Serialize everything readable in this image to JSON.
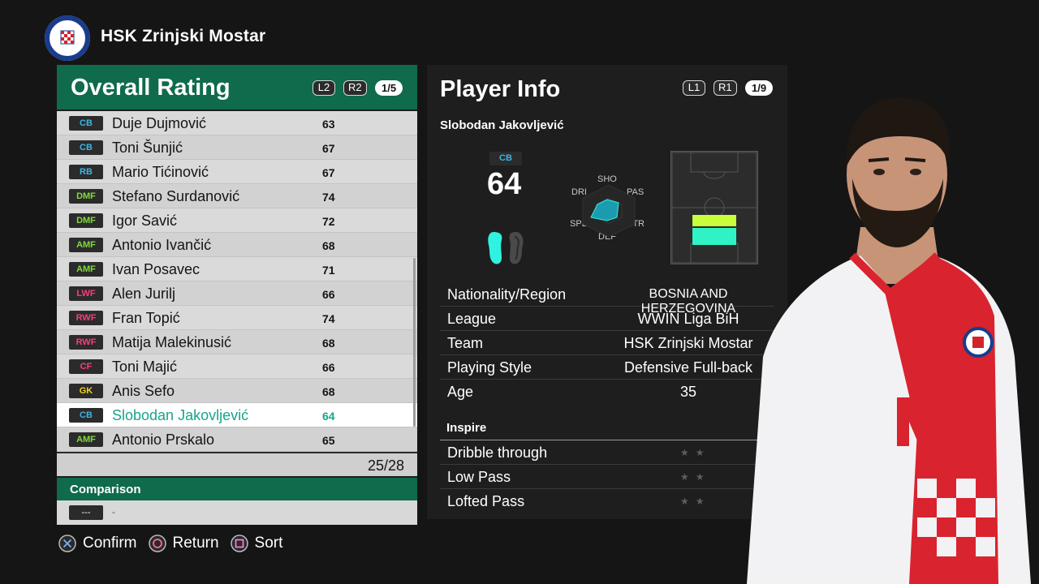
{
  "header": {
    "club_name": "HSK Zrinjski Mostar",
    "logo_colors": {
      "ring": "#1a3c8c",
      "inner": "#ffffff",
      "check": "#d2232a"
    }
  },
  "left_panel": {
    "title": "Overall Rating",
    "btn_l2": "L2",
    "btn_r2": "R2",
    "page": "1/5",
    "rows": [
      {
        "pos": "CB",
        "pos_color": "#3fb4e6",
        "name": "Duje Dujmović",
        "ovr": "63"
      },
      {
        "pos": "CB",
        "pos_color": "#3fb4e6",
        "name": "Toni Šunjić",
        "ovr": "67"
      },
      {
        "pos": "RB",
        "pos_color": "#3fb4e6",
        "name": "Mario Tićinović",
        "ovr": "67"
      },
      {
        "pos": "DMF",
        "pos_color": "#7fdc3a",
        "name": "Stefano Surdanović",
        "ovr": "74"
      },
      {
        "pos": "DMF",
        "pos_color": "#7fdc3a",
        "name": "Igor Savić",
        "ovr": "72"
      },
      {
        "pos": "AMF",
        "pos_color": "#7fdc3a",
        "name": "Antonio Ivančić",
        "ovr": "68"
      },
      {
        "pos": "AMF",
        "pos_color": "#7fdc3a",
        "name": "Ivan Posavec",
        "ovr": "71"
      },
      {
        "pos": "LWF",
        "pos_color": "#ff3a7a",
        "name": "Alen Jurilj",
        "ovr": "66"
      },
      {
        "pos": "RWF",
        "pos_color": "#ff3a7a",
        "name": "Fran Topić",
        "ovr": "74"
      },
      {
        "pos": "RWF",
        "pos_color": "#ff3a7a",
        "name": "Matija Malekinusić",
        "ovr": "68"
      },
      {
        "pos": "CF",
        "pos_color": "#ff3a7a",
        "name": "Toni Majić",
        "ovr": "66"
      },
      {
        "pos": "GK",
        "pos_color": "#f0d020",
        "name": "Anis Sefo",
        "ovr": "68"
      },
      {
        "pos": "CB",
        "pos_color": "#3fb4e6",
        "name": "Slobodan Jakovljević",
        "ovr": "64",
        "selected": true
      },
      {
        "pos": "AMF",
        "pos_color": "#7fdc3a",
        "name": "Antonio Prskalo",
        "ovr": "65"
      }
    ],
    "count": "25/28",
    "comparison_title": "Comparison",
    "comparison_badge": "---",
    "comparison_value": "-"
  },
  "hints": {
    "confirm": "Confirm",
    "return": "Return",
    "sort": "Sort"
  },
  "info_panel": {
    "title": "Player Info",
    "btn_l1": "L1",
    "btn_r1": "R1",
    "page": "1/9",
    "player_name": "Slobodan Jakovljević",
    "position": "CB",
    "overall": "64",
    "radar": {
      "SHO": "SHO",
      "PAS": "PAS",
      "STR": "STR",
      "DEF": "DEF",
      "SPD": "SPD",
      "DRI": "DRI"
    },
    "rows": [
      {
        "key": "Nationality/Region",
        "value": "BOSNIA AND HERZEGOVINA"
      },
      {
        "key": "League",
        "value": "WWIN Liga BiH"
      },
      {
        "key": "Team",
        "value": "HSK Zrinjski Mostar"
      },
      {
        "key": "Playing Style",
        "value": "Defensive Full-back"
      },
      {
        "key": "Age",
        "value": "35"
      }
    ],
    "inspire_title": "Inspire",
    "inspire": [
      {
        "key": "Dribble through",
        "stars": "★★"
      },
      {
        "key": "Low Pass",
        "stars": "★★"
      },
      {
        "key": "Lofted Pass",
        "stars": "★★"
      }
    ]
  },
  "colors": {
    "accent_green": "#0f6b4b",
    "selected_text": "#17a58a",
    "highlight_cyan": "#2ff3c5",
    "highlight_yellow": "#c8ff3a"
  }
}
